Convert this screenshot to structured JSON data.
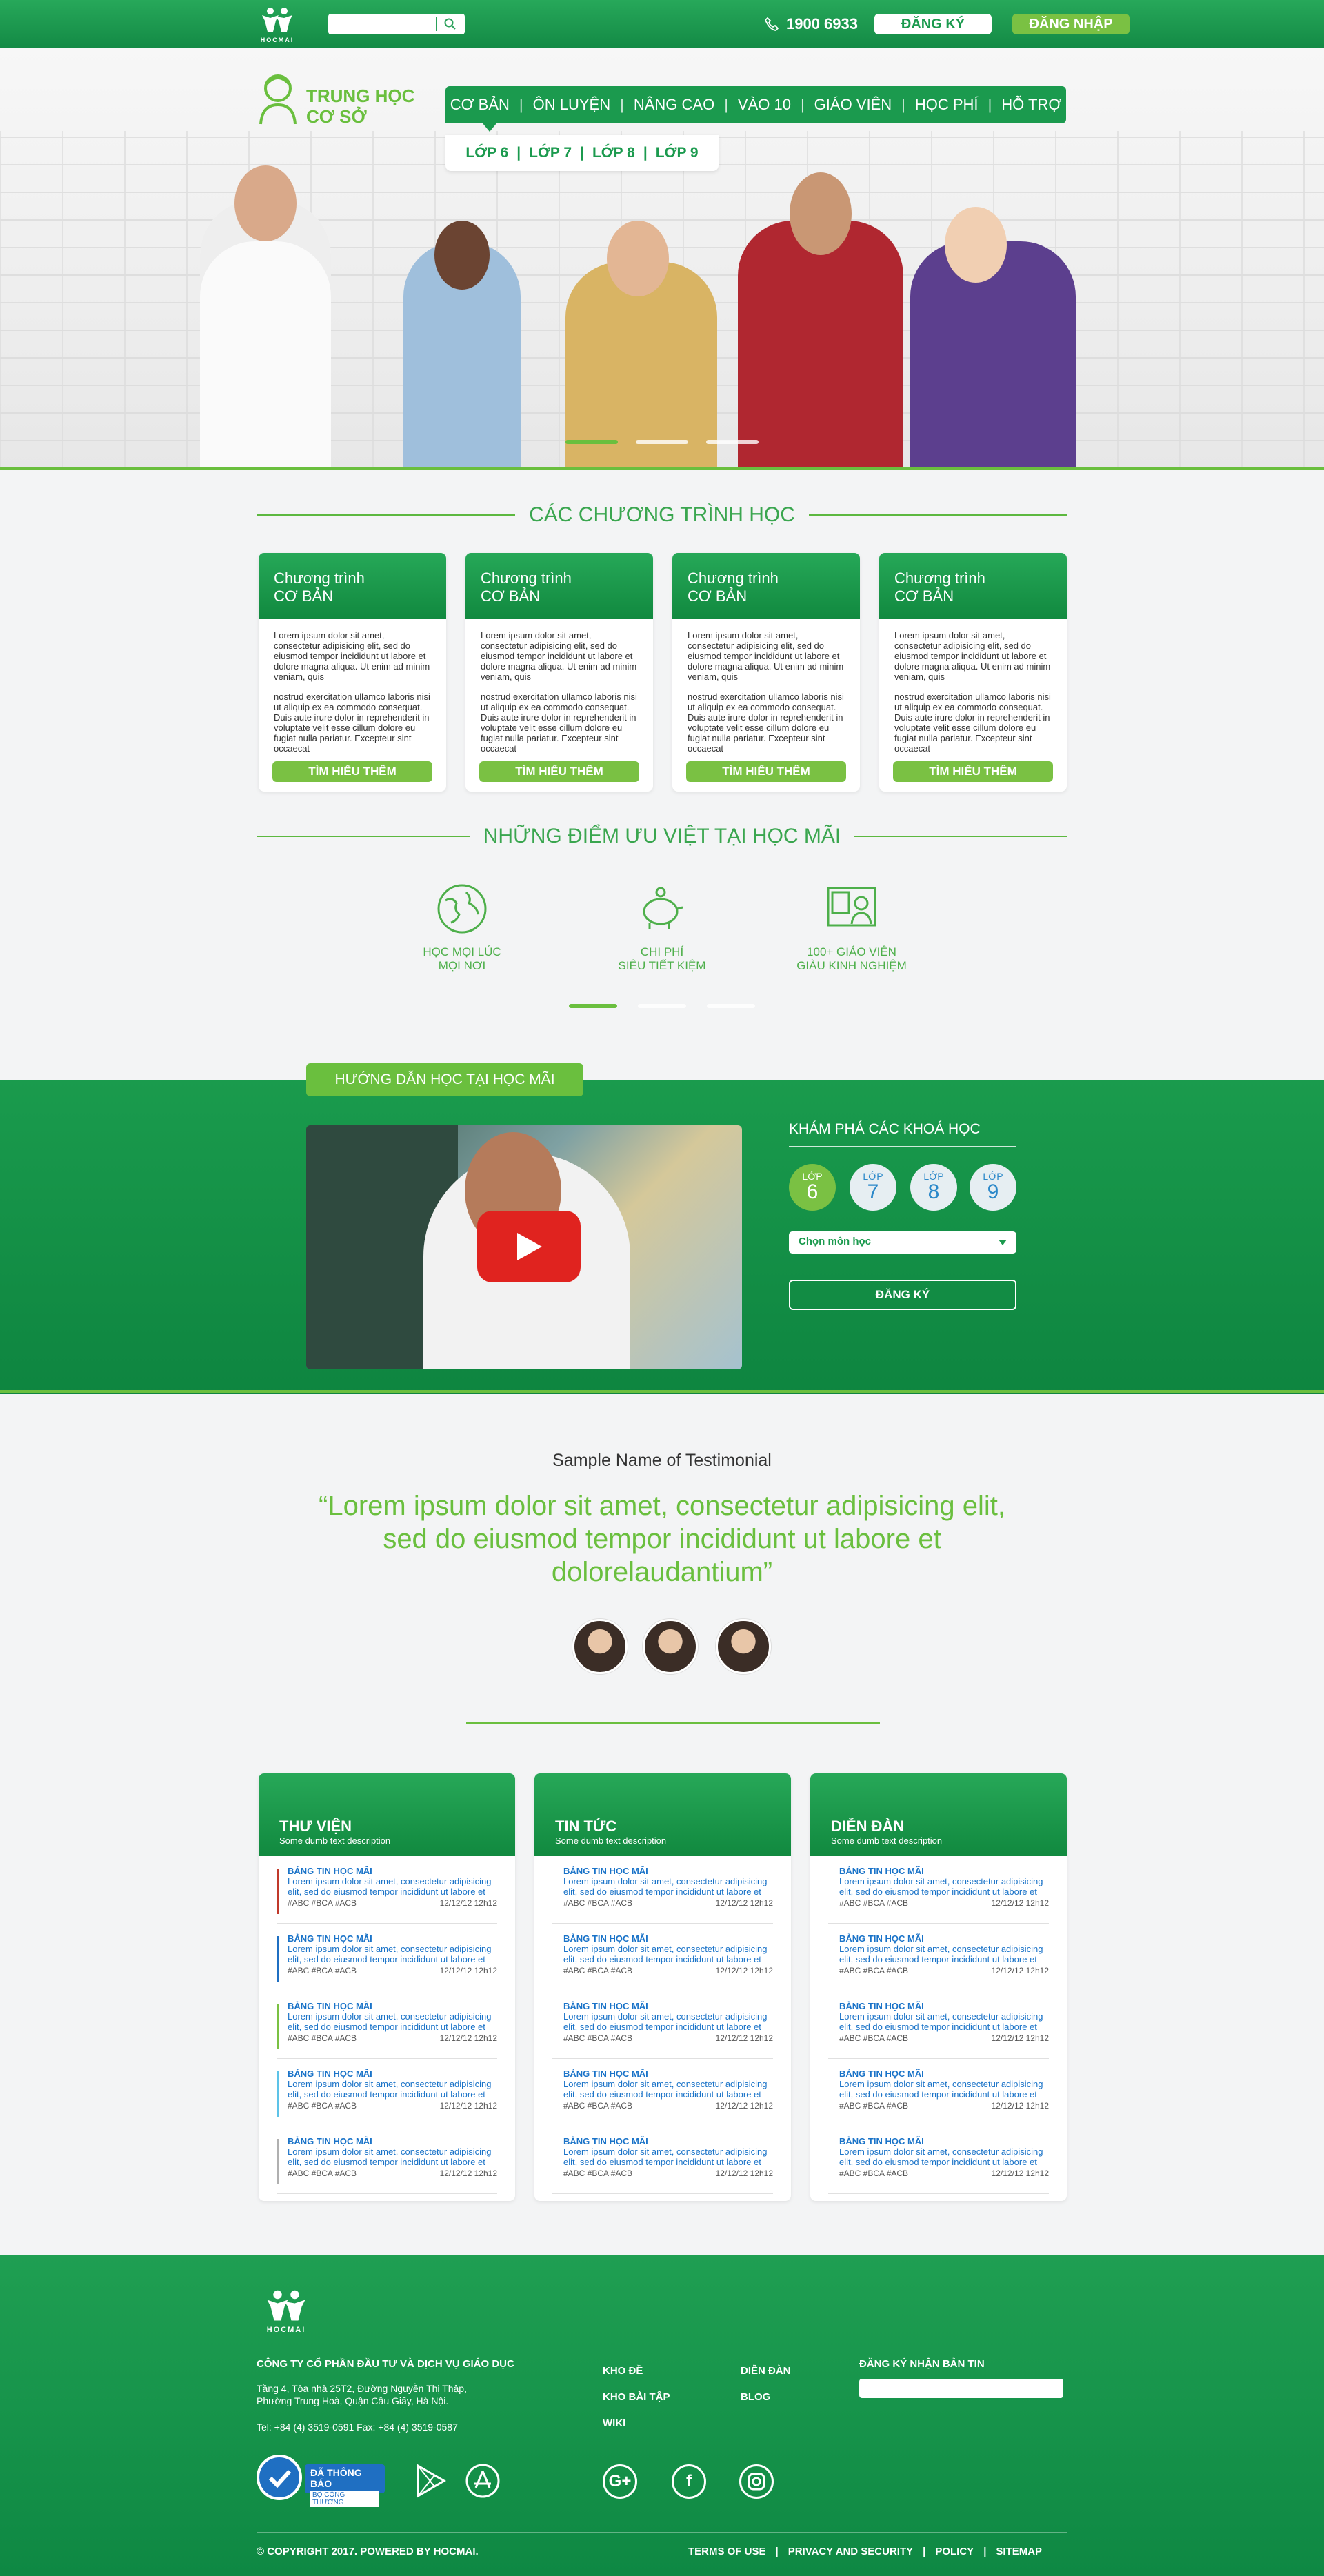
{
  "topbar": {
    "logo_text": "HOCMAI",
    "phone": "1900 6933",
    "register": "ĐĂNG KÝ",
    "login": "ĐĂNG NHẬP"
  },
  "brand": {
    "line1": "TRUNG HỌC",
    "line2": "CƠ SỞ"
  },
  "nav": {
    "items": [
      "CƠ BẢN",
      "ÔN LUYỆN",
      "NÂNG CAO",
      "VÀO 10",
      "GIÁO VIÊN",
      "HỌC PHÍ",
      "HỖ TRỢ"
    ],
    "sub": [
      "LỚP 6",
      "LỚP 7",
      "LỚP 8",
      "LỚP 9"
    ]
  },
  "programs": {
    "title": "CÁC CHƯƠNG TRÌNH HỌC",
    "cards": [
      {
        "title1": "Chương trình",
        "title2": "CƠ BẢN",
        "p1": "Lorem ipsum dolor sit amet, consectetur adipisicing elit, sed do eiusmod tempor incididunt ut labore et dolore magna aliqua. Ut enim ad minim veniam, quis",
        "p2": "nostrud exercitation ullamco laboris nisi ut aliquip ex ea commodo consequat. Duis aute irure dolor in reprehenderit in voluptate velit esse cillum dolore eu fugiat nulla pariatur. Excepteur sint occaecat",
        "button": "TÌM HIỂU THÊM"
      },
      {
        "title1": "Chương trình",
        "title2": "CƠ BẢN",
        "p1": "Lorem ipsum dolor sit amet, consectetur adipisicing elit, sed do eiusmod tempor incididunt ut labore et dolore magna aliqua. Ut enim ad minim veniam, quis",
        "p2": "nostrud exercitation ullamco laboris nisi ut aliquip ex ea commodo consequat. Duis aute irure dolor in reprehenderit in voluptate velit esse cillum dolore eu fugiat nulla pariatur. Excepteur sint occaecat",
        "button": "TÌM HIỂU THÊM"
      },
      {
        "title1": "Chương trình",
        "title2": "CƠ BẢN",
        "p1": "Lorem ipsum dolor sit amet, consectetur adipisicing elit, sed do eiusmod tempor incididunt ut labore et dolore magna aliqua. Ut enim ad minim veniam, quis",
        "p2": "nostrud exercitation ullamco laboris nisi ut aliquip ex ea commodo consequat. Duis aute irure dolor in reprehenderit in voluptate velit esse cillum dolore eu fugiat nulla pariatur. Excepteur sint occaecat",
        "button": "TÌM HIỂU THÊM"
      },
      {
        "title1": "Chương trình",
        "title2": "CƠ BẢN",
        "p1": "Lorem ipsum dolor sit amet, consectetur adipisicing elit, sed do eiusmod tempor incididunt ut labore et dolore magna aliqua. Ut enim ad minim veniam, quis",
        "p2": "nostrud exercitation ullamco laboris nisi ut aliquip ex ea commodo consequat. Duis aute irure dolor in reprehenderit in voluptate velit esse cillum dolore eu fugiat nulla pariatur. Excepteur sint occaecat",
        "button": "TÌM HIỂU THÊM"
      }
    ]
  },
  "features": {
    "title": "NHỮNG ĐIỂM ƯU VIỆT TẠI HỌC MÃI",
    "items": [
      {
        "l1": "HỌC MỌI LÚC",
        "l2": "MỌI NƠI",
        "icon": "globe-icon"
      },
      {
        "l1": "CHI PHÍ",
        "l2": "SIÊU TIẾT KIỆM",
        "icon": "piggy-bank-icon"
      },
      {
        "l1": "100+ GIÁO VIÊN",
        "l2": "GIÀU KINH NGHIỆM",
        "icon": "teacher-board-icon"
      }
    ]
  },
  "guide": {
    "tag": "HƯỚNG DẪN HỌC TẠI HỌC MÃI",
    "explore_title": "KHÁM PHÁ CÁC KHOÁ HỌC",
    "grade_label": "LỚP",
    "grades": [
      "6",
      "7",
      "8",
      "9"
    ],
    "select_placeholder": "Chọn môn học",
    "register": "ĐĂNG KÝ"
  },
  "testimonial": {
    "name": "Sample Name of Testimonial",
    "quote": "“Lorem ipsum dolor sit amet, consectetur adipisicing elit, sed do eiusmod tempor incididunt ut labore et dolorelaudantium”"
  },
  "news": [
    {
      "title": "THƯ VIỆN",
      "sub": "Some dumb text description",
      "bars": [
        "#c0392b",
        "#1f6fc2",
        "#7ac143",
        "#5dc3e8",
        "#b0b0b0"
      ]
    },
    {
      "title": "TIN TỨC",
      "sub": "Some dumb text description",
      "bars": []
    },
    {
      "title": "DIỄN ĐÀN",
      "sub": "Some dumb text description",
      "bars": []
    }
  ],
  "news_item": {
    "title": "BẢNG TIN HỌC MÃI",
    "desc": "Lorem ipsum dolor sit amet, consectetur adipisicing elit, sed do eiusmod tempor incididunt ut labore et",
    "tags": "#ABC #BCA #ACB",
    "date": "12/12/12 12h12"
  },
  "footer": {
    "logo_text": "HOCMAI",
    "company": "CÔNG TY CỔ PHẦN ĐẦU TƯ VÀ DỊCH VỤ GIÁO DỤC",
    "address1": "Tầng 4, Tòa nhà 25T2, Đường Nguyễn Thị Thập,",
    "address2": "Phường Trung Hoà, Quận Cầu Giấy, Hà Nội.",
    "contact": "Tel: +84 (4) 3519-0591 Fax: +84 (4) 3519-0587",
    "links_col1": [
      "KHO ĐỀ",
      "KHO BÀI TẬP",
      "WIKI"
    ],
    "links_col2": [
      "DIỄN ĐÀN",
      "BLOG"
    ],
    "newsletter": "ĐĂNG KÝ NHẬN BẢN TIN",
    "badge1": "ĐÃ THÔNG BÁO",
    "badge2": "BỘ CÔNG THƯƠNG",
    "copyright": "© COPYRIGHT 2017. POWERED BY HOCMAI.",
    "bottom_links": [
      "TERMS OF USE",
      "PRIVACY AND SECURITY",
      "POLICY",
      "SITEMAP"
    ]
  }
}
